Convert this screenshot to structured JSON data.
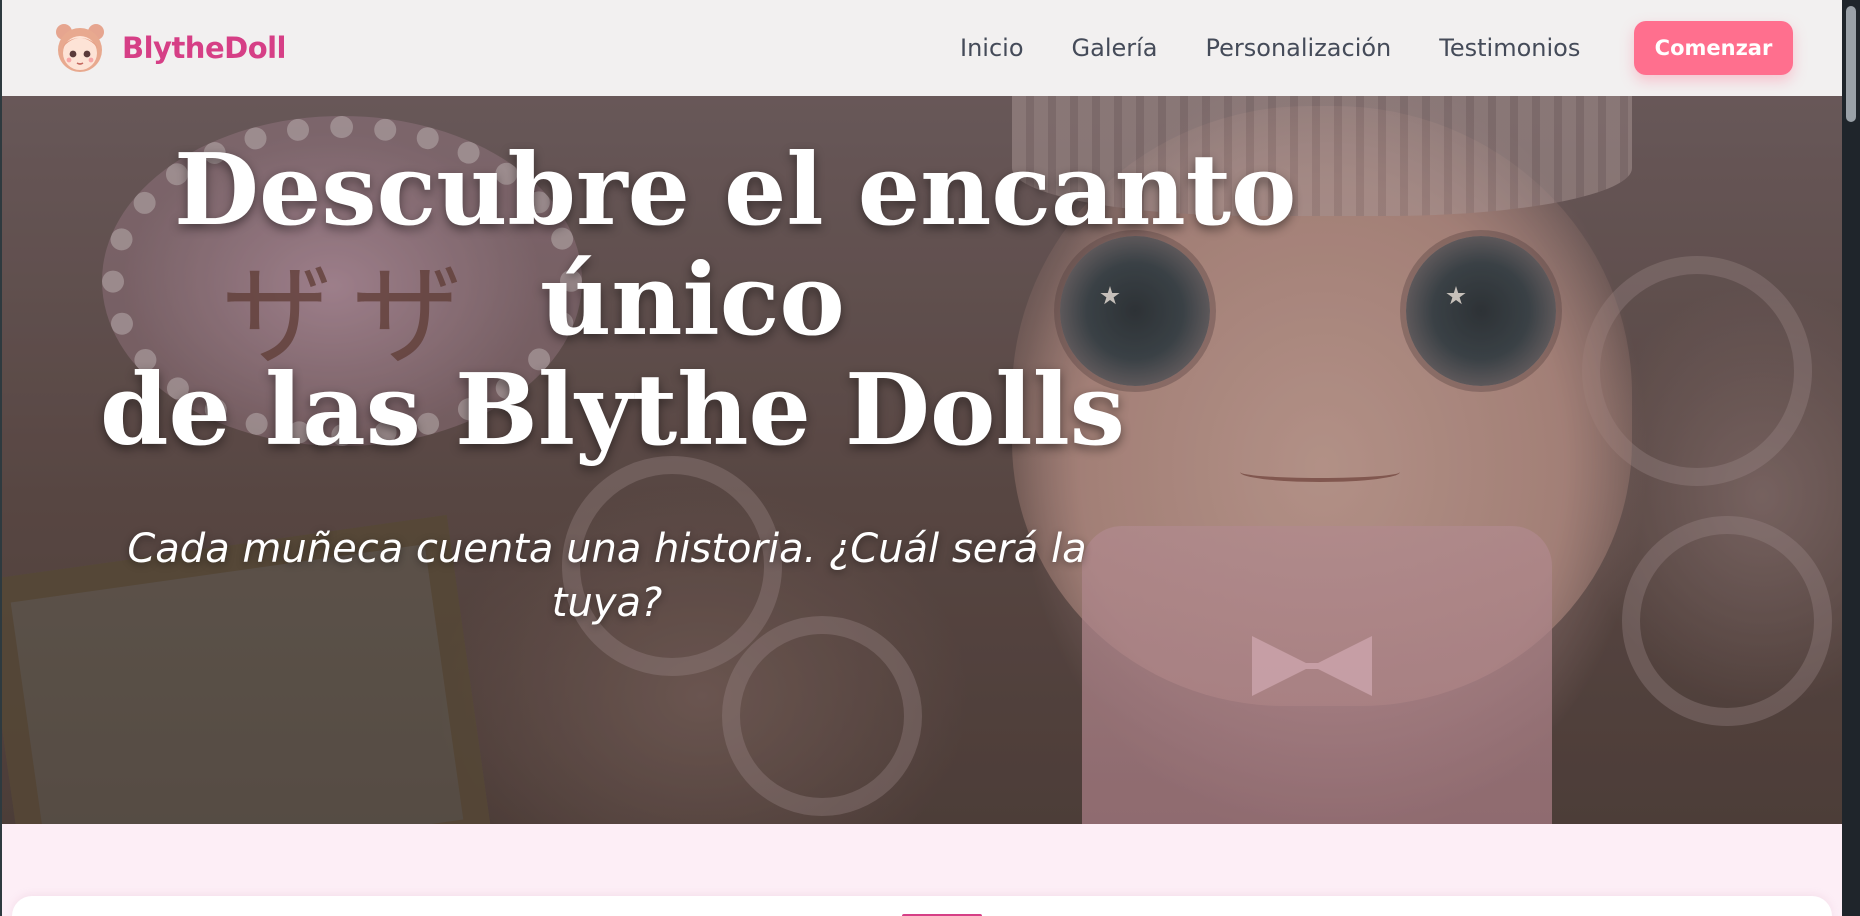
{
  "brand": {
    "name": "BlytheDoll",
    "logo_icon": "doll-face-icon",
    "color": "#d63f86"
  },
  "nav": {
    "items": [
      {
        "label": "Inicio"
      },
      {
        "label": "Galería"
      },
      {
        "label": "Personalización"
      },
      {
        "label": "Testimonios"
      }
    ],
    "cta_label": "Comenzar",
    "cta_color": "#ff6f8e"
  },
  "hero": {
    "title_line_1": "Descubre el encanto",
    "title_line_2": "único",
    "title_line_3": "de las Blythe Dolls",
    "subtitle": "Cada muñeca cuenta una historia. ¿Cuál será la tuya?",
    "background_kana": "ザザ"
  },
  "colors": {
    "page_background": "#fdeef6",
    "nav_background": "#f2f0f0",
    "nav_text": "#454b59"
  }
}
